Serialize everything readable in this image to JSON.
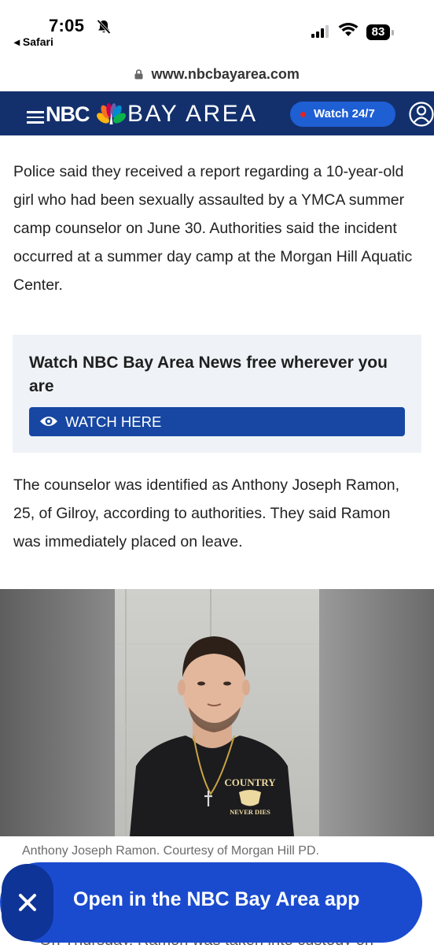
{
  "status_bar": {
    "time": "7:05",
    "back_app": "◂ Safari",
    "battery_level": "83"
  },
  "browser": {
    "url": "www.nbcbayarea.com"
  },
  "site_header": {
    "logo_nbc": "NBC",
    "logo_region": "BAY AREA",
    "live_button": "Watch 24/7"
  },
  "article": {
    "paragraph_1": "Police said they received a report regarding a 10-year-old girl who had been sexually assaulted by a YMCA summer camp counselor on June 30. Authorities said the incident occurred at a summer day camp at the Morgan Hill Aquatic Center.",
    "paragraph_2": "The counselor was identified as Anthony Joseph Ramon, 25, of Gilroy, according to authorities. They said Ramon was immediately placed on leave.",
    "photo_caption": "Anthony Joseph Ramon. Courtesy of Morgan Hill PD.",
    "shirt_text_top": "COUNTRY",
    "shirt_text_bottom": "NEVER DIES",
    "cutoff_line": "On Thursday, Ramon was taken into custody on"
  },
  "promo": {
    "title": "Watch NBC Bay Area News free wherever you are",
    "button_label": "WATCH HERE"
  },
  "app_banner": {
    "label": "Open in the NBC Bay Area app"
  },
  "colors": {
    "header_navy": "#13306d",
    "live_blue": "#1f5fd4",
    "promo_button": "#1747a3",
    "banner_blue": "#1a4bcf",
    "promo_bg": "#eff3f8"
  }
}
